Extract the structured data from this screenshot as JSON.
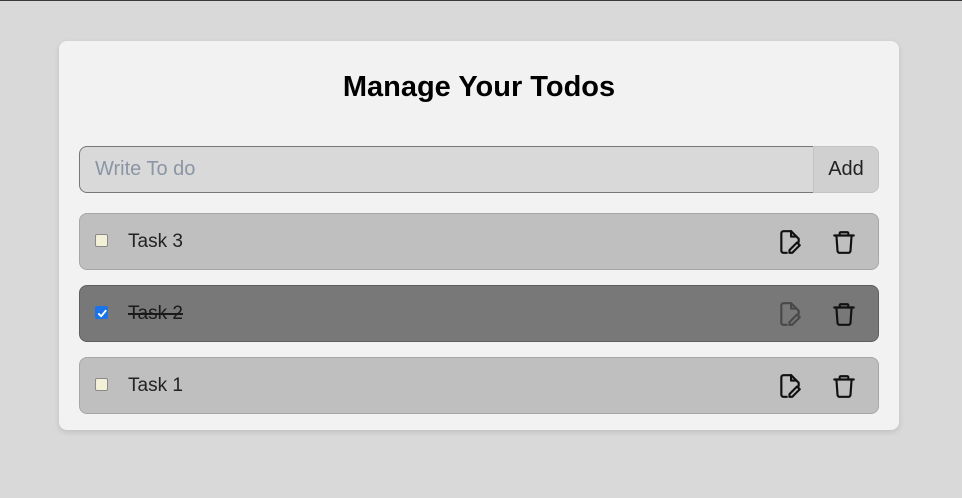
{
  "page": {
    "title": "Manage Your Todos"
  },
  "form": {
    "input_value": "",
    "input_placeholder": "Write To do",
    "add_label": "Add"
  },
  "todos": [
    {
      "text": "Task 3",
      "completed": false
    },
    {
      "text": "Task 2",
      "completed": true
    },
    {
      "text": "Task 1",
      "completed": false
    }
  ],
  "icons": {
    "edit": "edit-file-icon",
    "delete": "trash-icon"
  },
  "colors": {
    "background": "#d9d9d9",
    "card": "#f2f2f2",
    "todo_item": "#bfbfbf",
    "todo_item_done": "#787878",
    "checkbox_checked": "#1a73e8"
  }
}
